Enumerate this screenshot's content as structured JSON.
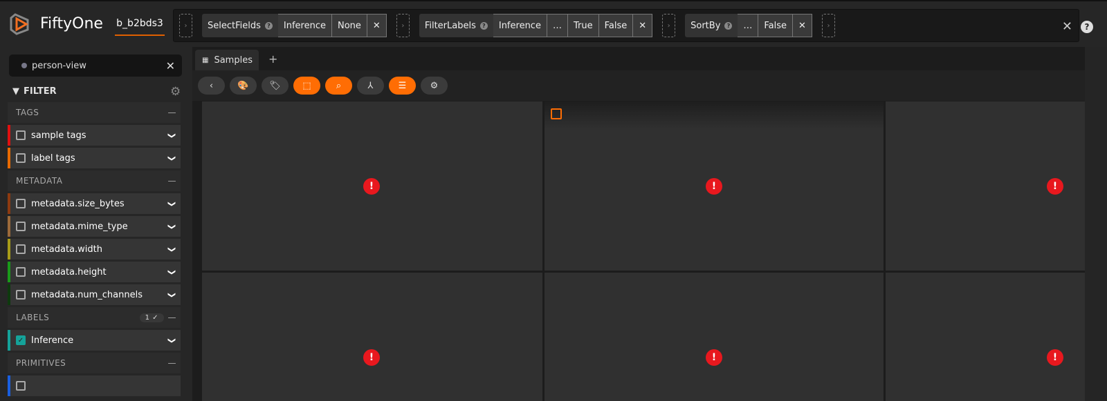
{
  "app": {
    "name": "FiftyOne",
    "dataset": "b_b2bds3"
  },
  "view_bar": {
    "stages": [
      {
        "name": "SelectFields",
        "params": [
          "Inference",
          "None"
        ]
      },
      {
        "name": "FilterLabels",
        "params": [
          "Inference",
          "…",
          "True",
          "False"
        ]
      },
      {
        "name": "SortBy",
        "params": [
          "…",
          "False"
        ]
      }
    ],
    "close": "✕",
    "help": "?"
  },
  "sidebar": {
    "saved_view": "person-view",
    "filter_title": "FILTER",
    "groups": [
      {
        "title": "TAGS",
        "items": [
          {
            "label": "sample tags",
            "color": "#e01010"
          },
          {
            "label": "label tags",
            "color": "#e86a00"
          }
        ]
      },
      {
        "title": "METADATA",
        "items": [
          {
            "label": "metadata.size_bytes",
            "color": "#8e3a10"
          },
          {
            "label": "metadata.mime_type",
            "color": "#9c6a3a"
          },
          {
            "label": "metadata.width",
            "color": "#a89c18"
          },
          {
            "label": "metadata.height",
            "color": "#1a9a1a"
          },
          {
            "label": "metadata.num_channels",
            "color": "#0e3a0e"
          }
        ]
      },
      {
        "title": "LABELS",
        "badge": "1 ✓",
        "items": [
          {
            "label": "Inference",
            "color": "#15a39a",
            "checked": true
          }
        ]
      },
      {
        "title": "PRIMITIVES",
        "items": []
      }
    ]
  },
  "tabs": {
    "samples": "Samples",
    "add": "+"
  }
}
